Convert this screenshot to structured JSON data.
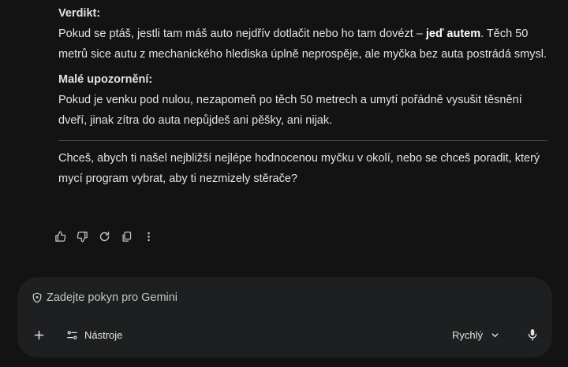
{
  "response": {
    "verdict_heading": "Verdikt:",
    "verdict_pre": "Pokud se ptáš, jestli tam máš auto nejdřív dotlačit nebo ho tam dovézt – ",
    "verdict_bold": "jeď autem",
    "verdict_post": ". Těch 50 metrů sice autu z mechanického hlediska úplně neprospěje, ale myčka bez auta postrádá smysl.",
    "warning_heading": "Malé upozornění:",
    "warning_text": "Pokud je venku pod nulou, nezapomeň po těch 50 metrech a umytí pořádně vysušit těsnění dveří, jinak zítra do auta nepůjdeš ani pěšky, ani nijak.",
    "question_text": "Chceš, abych ti našel nejbližší nejlépe hodnocenou myčku v okolí, nebo se chceš poradit, který mycí program vybrat, aby ti nezmizely stěrače?"
  },
  "actions": [
    {
      "name": "thumb-up-icon"
    },
    {
      "name": "thumb-down-icon"
    },
    {
      "name": "regenerate-icon"
    },
    {
      "name": "copy-icon"
    },
    {
      "name": "more-vertical-icon"
    }
  ],
  "composer": {
    "placeholder": "Zadejte pokyn pro Gemini",
    "tools_label": "Nástroje",
    "mode_label": "Rychlý",
    "icons": {
      "add": "plus-icon",
      "tools": "tools-sliders-icon",
      "mode": "chevron-down-icon",
      "mic": "microphone-icon",
      "prompt": "shield-icon"
    }
  },
  "colors": {
    "background": "#131314",
    "composer_bg": "#1e1f20",
    "text": "#e3e3e3",
    "muted": "#c4c7c5",
    "divider": "#444746"
  }
}
